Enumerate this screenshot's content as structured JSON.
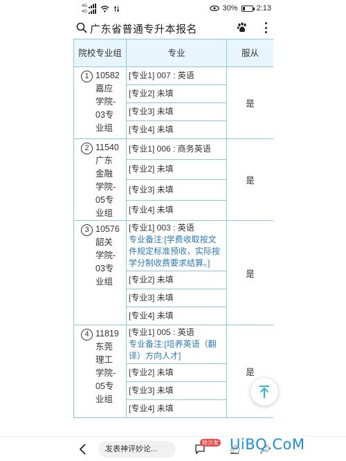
{
  "status_bar": {
    "signal_tag_1": "4G",
    "signal_tag_2": "4G",
    "battery": "30%",
    "time": "2:13",
    "battery_level": 0.3
  },
  "header": {
    "search_text": "广东省普通专升本报名"
  },
  "table": {
    "headers": {
      "group": "院校专业组",
      "major": "专业",
      "obey": "服从"
    },
    "groups": [
      {
        "num": "1",
        "name": "10582嘉应学院-03专业组",
        "obey": "是",
        "majors": [
          {
            "text": "[专业1] 007 : 英语",
            "note": ""
          },
          {
            "text": "[专业2] 未填",
            "note": ""
          },
          {
            "text": "[专业3] 未填",
            "note": ""
          },
          {
            "text": "[专业4] 未填",
            "note": ""
          }
        ]
      },
      {
        "num": "2",
        "name": "11540广东金融学院-05专业组",
        "obey": "是",
        "majors": [
          {
            "text": "[专业1] 006 : 商务英语",
            "note": ""
          },
          {
            "text": "[专业2] 未填",
            "note": ""
          },
          {
            "text": "[专业3] 未填",
            "note": ""
          },
          {
            "text": "[专业4] 未填",
            "note": ""
          }
        ]
      },
      {
        "num": "3",
        "name": "10576韶关学院-03专业组",
        "obey": "是",
        "majors": [
          {
            "text": "[专业1] 003 : 英语",
            "note": "专业备注:[学费收取按文件规定标准预收，实际按学分制收费要求结算。]"
          },
          {
            "text": "[专业2] 未填",
            "note": ""
          },
          {
            "text": "[专业3] 未填",
            "note": ""
          },
          {
            "text": "[专业4] 未填",
            "note": ""
          }
        ]
      },
      {
        "num": "4",
        "name": "11819东莞理工学院-05专业组",
        "obey": "是",
        "majors": [
          {
            "text": "[专业1] 005 : 英语",
            "note": "专业备注:[培养英语（翻译）方向人才]"
          },
          {
            "text": "[专业2] 未填",
            "note": ""
          },
          {
            "text": "[专业3] 未填",
            "note": ""
          },
          {
            "text": "[专业4] 未填",
            "note": ""
          }
        ]
      }
    ]
  },
  "bottom_bar": {
    "comment_placeholder": "发表神评妙论...",
    "sofa_badge": "抢沙发"
  },
  "watermark": "UiBQ.CoM"
}
